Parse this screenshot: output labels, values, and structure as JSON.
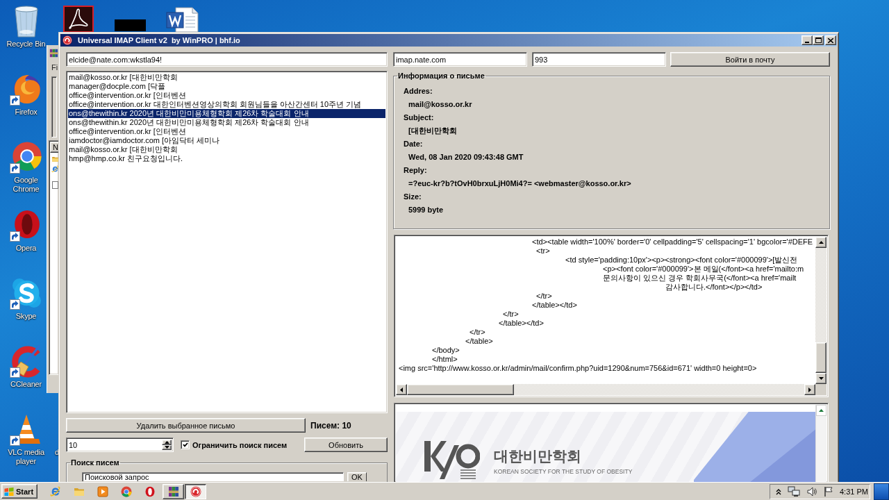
{
  "desktop": {
    "icons": [
      {
        "label": "Recycle Bin",
        "kind": "bin"
      },
      {
        "label": "Firefox",
        "kind": "fox"
      },
      {
        "label": "Google Chrome",
        "kind": "chrome"
      },
      {
        "label": "Opera",
        "kind": "opera"
      },
      {
        "label": "Skype",
        "kind": "skype"
      },
      {
        "label": "CCleaner",
        "kind": "ccleaner"
      },
      {
        "label": "VLC media player",
        "kind": "vlc"
      }
    ],
    "top_icons": [
      {
        "kind": "pdf"
      },
      {
        "kind": "block"
      },
      {
        "kind": "word"
      }
    ],
    "covered_label": "d"
  },
  "background_window": {
    "menu": "Fi",
    "column_header": "N"
  },
  "window": {
    "title": "Universal IMAP Client v2  by WinPRO | bhf.io"
  },
  "account": {
    "login": "elcide@nate.com:wkstla94!",
    "server": "imap.nate.com",
    "port": "993",
    "login_button": "Войти в почту"
  },
  "messages": [
    {
      "text": "mail@kosso.or.kr [대한비만학회",
      "selected": false
    },
    {
      "text": "manager@docple.com [닥플",
      "selected": false
    },
    {
      "text": "office@intervention.or.kr [인터벤션",
      "selected": false
    },
    {
      "text": "office@intervention.or.kr 대한인터벤션영상의학회 회원님들을 아산간센터 10주년 기념",
      "selected": false
    },
    {
      "text": "ons@thewithin.kr 2020년 대한비만미용체형학회 제26차 학술대회 안내",
      "selected": true
    },
    {
      "text": "ons@thewithin.kr 2020년 대한비만미용체형학회 제26차 학술대회 안내",
      "selected": false
    },
    {
      "text": "office@intervention.or.kr [인터벤션",
      "selected": false
    },
    {
      "text": "iamdoctor@iamdoctor.com [아임닥터 세미나",
      "selected": false
    },
    {
      "text": "mail@kosso.or.kr [대한비만학회",
      "selected": false
    },
    {
      "text": "hmp@hmp.co.kr 친구요청입니다.",
      "selected": false
    }
  ],
  "delete_button": "Удалить выбранное письмо",
  "message_count": "Писем: 10",
  "limit": {
    "value": "10",
    "checked": true,
    "label": "Ограничить поиск писем"
  },
  "refresh_button": "Обновить",
  "search": {
    "title": "Поиск писем",
    "value": "Поисковой запрос",
    "button": "OK"
  },
  "info": {
    "title": "Информация о письме",
    "fields": [
      {
        "label": "Addres:",
        "value": "mail@kosso.or.kr"
      },
      {
        "label": "Subject:",
        "value": "[대한비만학회"
      },
      {
        "label": "Date:",
        "value": "Wed, 08 Jan 2020 09:43:48 GMT"
      },
      {
        "label": "Reply:",
        "value": "=?euc-kr?b?tOvH0brxuLjH0Mi4?= <webmaster@kosso.or.kr>"
      },
      {
        "label": "Size:",
        "value": "5999 byte"
      }
    ]
  },
  "html_source": {
    "lines": [
      "\t\t\t\t<td><table width='100%' border='0' cellpadding='5' cellspacing='1' bgcolor='#DEFE",
      "\t\t\t\t <tr>",
      "\t\t\t\t\t<td style='padding:10px'><p><strong><font color='#000099'>[발신전",
      "\t\t\t\t\t\t <p><font color='#000099'>본 메일(</font><a href='mailto:m",
      "\t\t\t\t\t\t 문의사항이 있으신 경우 학회사무국(</font><a href='mailt",
      "\t\t\t\t\t\t\t\t감사합니다.</font></p></td>",
      "\t\t\t\t </tr>",
      "\t\t\t\t</table></td>",
      "\t\t\t </tr>",
      "\t\t\t</table></td>",
      "\t\t </tr>",
      "\t\t</table>",
      "\t</body>",
      "\t</html>",
      "<img src='http://www.kosso.or.kr/admin/mail/confirm.php?uid=1290&num=756&id=671' width=0 height=0>"
    ]
  },
  "preview": {
    "heading": "대한비만학회",
    "subtitle": "KOREAN SOCIETY FOR THE STUDY OF OBESITY"
  },
  "taskbar": {
    "start": "Start",
    "quick_launch": [
      {
        "kind": "ie"
      },
      {
        "kind": "folder"
      },
      {
        "kind": "media"
      },
      {
        "kind": "chrome"
      },
      {
        "kind": "opera"
      }
    ],
    "tasks": [
      {
        "kind": "rar",
        "selected": false
      },
      {
        "kind": "imap",
        "selected": true
      }
    ],
    "clock": "4:31 PM"
  }
}
